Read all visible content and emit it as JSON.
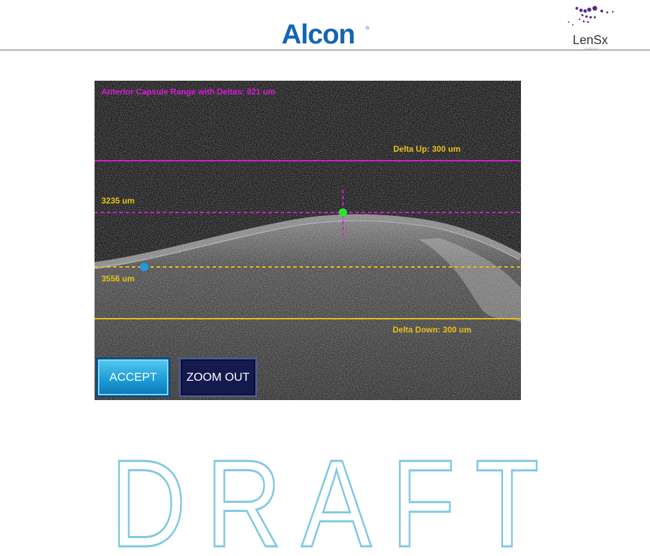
{
  "header": {
    "left_logo_text": "Alcon",
    "left_logo_mark": "®",
    "right_logo_text": "LenSx",
    "right_logo_sub": "LASERS"
  },
  "oct": {
    "range_label": "Anterior Capsule Range with Deltas: 921 um",
    "delta_up_label": "Delta Up: 300 um",
    "upper_depth_label": "3235 um",
    "lower_depth_label": "3556 um",
    "delta_down_label": "Delta Down: 300 um",
    "colors": {
      "magenta": "#d81ad8",
      "yellow": "#e8c21a",
      "green_marker": "#2ee02e",
      "blue_marker": "#1aa0e0"
    }
  },
  "buttons": {
    "accept_label": "ACCEPT",
    "zoom_out_label": "ZOOM OUT"
  },
  "watermark": {
    "text": "DRAFT",
    "color": "#7ec8e3"
  }
}
